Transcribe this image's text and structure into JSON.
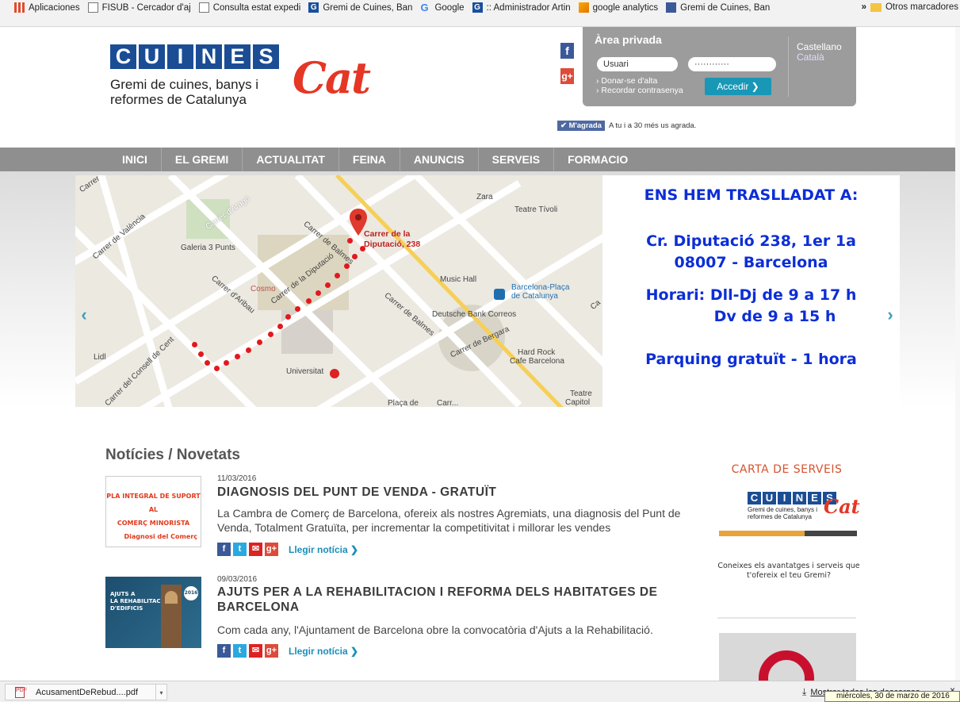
{
  "bookmarks": {
    "items": [
      {
        "label": "Aplicaciones",
        "icon": "apps-grid-icon"
      },
      {
        "label": "FISUB - Cercador d'aj",
        "icon": "page-icon"
      },
      {
        "label": "Consulta estat expedi",
        "icon": "page-icon"
      },
      {
        "label": "Gremi de Cuines, Ban",
        "icon": "gremi-icon"
      },
      {
        "label": "Google",
        "icon": "google-icon"
      },
      {
        "label": ":: Administrador Artin",
        "icon": "gremi-icon"
      },
      {
        "label": "google analytics",
        "icon": "analytics-icon"
      },
      {
        "label": "Gremi de Cuines, Ban",
        "icon": "facebook-icon"
      }
    ],
    "more": "»",
    "other": "Otros marcadores"
  },
  "header": {
    "logo_letters": [
      "C",
      "U",
      "I",
      "N",
      "E",
      "S"
    ],
    "logo_cat": "Cat",
    "tagline_1": "Gremi de cuines, banys i",
    "tagline_2": "reformes de Catalunya",
    "fb": "f",
    "gplus": "g+"
  },
  "private_area": {
    "title": "Àrea privada",
    "user_value": "Usuari",
    "password_value": "············",
    "signup": "› Donar-se d'alta",
    "remember": "› Recordar contrasenya",
    "login_button": "Accedir ❯",
    "lang_es": "Castellano",
    "lang_ca": "Català"
  },
  "fb_like": {
    "button": "✔ M'agrada",
    "text": "A tu i a 30 més us agrada."
  },
  "nav": {
    "items": [
      "INICI",
      "EL GREMI",
      "ACTUALITAT",
      "FEINA",
      "ANUNCIS",
      "SERVEIS",
      "FORMACIO"
    ]
  },
  "slider": {
    "headline": "ENS HEM TRASLLADAT A:",
    "address_1": "Cr. Diputació 238, 1er 1a",
    "address_2": "08007 - Barcelona",
    "hours_1": "Horari: Dll-Dj de 9 a 17 h",
    "hours_2": "Dv de 9 a 15 h",
    "parking": "Parquing gratuït - 1 hora",
    "prev": "‹",
    "next": "›"
  },
  "map": {
    "labels": {
      "carrer": "Carrer",
      "zara": "Zara",
      "tivoli": "Teatre Tívoli",
      "arago": "Carrer d'Aragó",
      "valencia": "Carrer de València",
      "galeria": "Galeria 3 Punts",
      "balmes_1": "Carrer de Balmes",
      "marker_1": "Carrer de la",
      "marker_2": "Diputació, 238",
      "cosmo": "Cosmo",
      "diputacio": "Carrer de la Diputació",
      "aribau": "Carrer d'Aribau",
      "music_hall": "Music Hall",
      "placa_1": "Barcelona-Plaça",
      "placa_2": "de Catalunya",
      "deutsche": "Deutsche Bank Correos",
      "balmes_2": "Carrer de Balmes",
      "bergara": "Carrer de Bergara",
      "lidl": "Lidl",
      "consell": "Carrer del Consell de Cent",
      "hardrock_1": "Hard Rock",
      "hardrock_2": "Cafe Barcelona",
      "universitat": "Universitat",
      "placa_de": "Plaça de",
      "carrer_cut": "Carr...",
      "teatre": "Teatre",
      "capitol": "Capitol",
      "ca": "Ca"
    }
  },
  "news": {
    "title": "Notícies / Novetats",
    "items": [
      {
        "date": "11/03/2016",
        "headline": "DIAGNOSIS DEL PUNT DE VENDA - GRATUÏT",
        "body": "La Cambra de Comerç de Barcelona, ofereix als nostres Agremiats, una diagnosis del Punt de Venda, Totalment Gratuïta, per incrementar la competitivitat i millorar les vendes",
        "thumb_line_1": "PLA INTEGRAL DE SUPORT AL",
        "thumb_line_2": "COMERÇ MINORISTA",
        "thumb_line_3": "Diagnosi del Comerç",
        "read_more": "Llegir notícia ❯"
      },
      {
        "date": "09/03/2016",
        "headline": "AJUTS PER A LA REHABILITACION I REFORMA DELS HABITATGES DE BARCELONA",
        "body": "Com cada any, l'Ajuntament de Barcelona obre la convocatòria d'Ajuts a la Rehabilitació.",
        "thumb_line_1": "AJUTS A",
        "thumb_line_2": "LA REHABILITACIÓ",
        "thumb_line_3": "D'EDIFICIS",
        "thumb_year": "2016",
        "read_more": "Llegir notícia ❯"
      }
    ],
    "share": {
      "fb": "f",
      "tw": "t",
      "mail": "✉",
      "gp": "g+"
    }
  },
  "sidebar": {
    "card_title": "CARTA DE SERVEIS",
    "logo_letters": [
      "C",
      "U",
      "I",
      "N",
      "E",
      "S"
    ],
    "logo_cat": "Cat",
    "logo_tag_1": "Gremi de cuines, banys i",
    "logo_tag_2": "reformes de Catalunya",
    "desc_1": "Coneixes els avantatges i serveis que",
    "desc_2": "t'ofereix el teu Gremi?"
  },
  "downloads": {
    "file": "AcusamentDeRebud....pdf",
    "file_icon": "PDF",
    "arrow": "▾",
    "show_all": "Mostrar todas las descargas...",
    "close": "×",
    "tooltip": "miércoles, 30 de marzo de 2016"
  },
  "colors": {
    "brand_blue": "#1b4d95",
    "brand_red": "#e53626",
    "slide_blue": "#0c2ed6",
    "nav_grey": "#8f8f8f",
    "link_teal": "#1a8fb8"
  }
}
